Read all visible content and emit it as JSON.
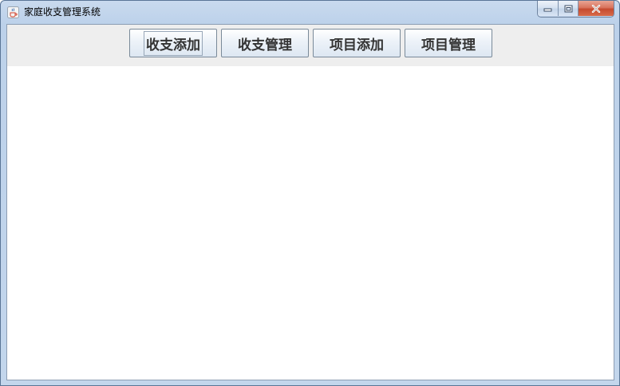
{
  "window": {
    "title": "家庭收支管理系统",
    "icon": "java-cup-icon",
    "controls": [
      "minimize-icon",
      "maximize-icon",
      "close-icon"
    ]
  },
  "toolbar": {
    "buttons": [
      {
        "label": "收支添加",
        "focused": true
      },
      {
        "label": "收支管理",
        "focused": false
      },
      {
        "label": "项目添加",
        "focused": false
      },
      {
        "label": "项目管理",
        "focused": false
      }
    ]
  },
  "colors": {
    "toolbar_bg": "#eeeeee",
    "content_bg": "#ffffff",
    "close_button": "#c54a2f"
  }
}
